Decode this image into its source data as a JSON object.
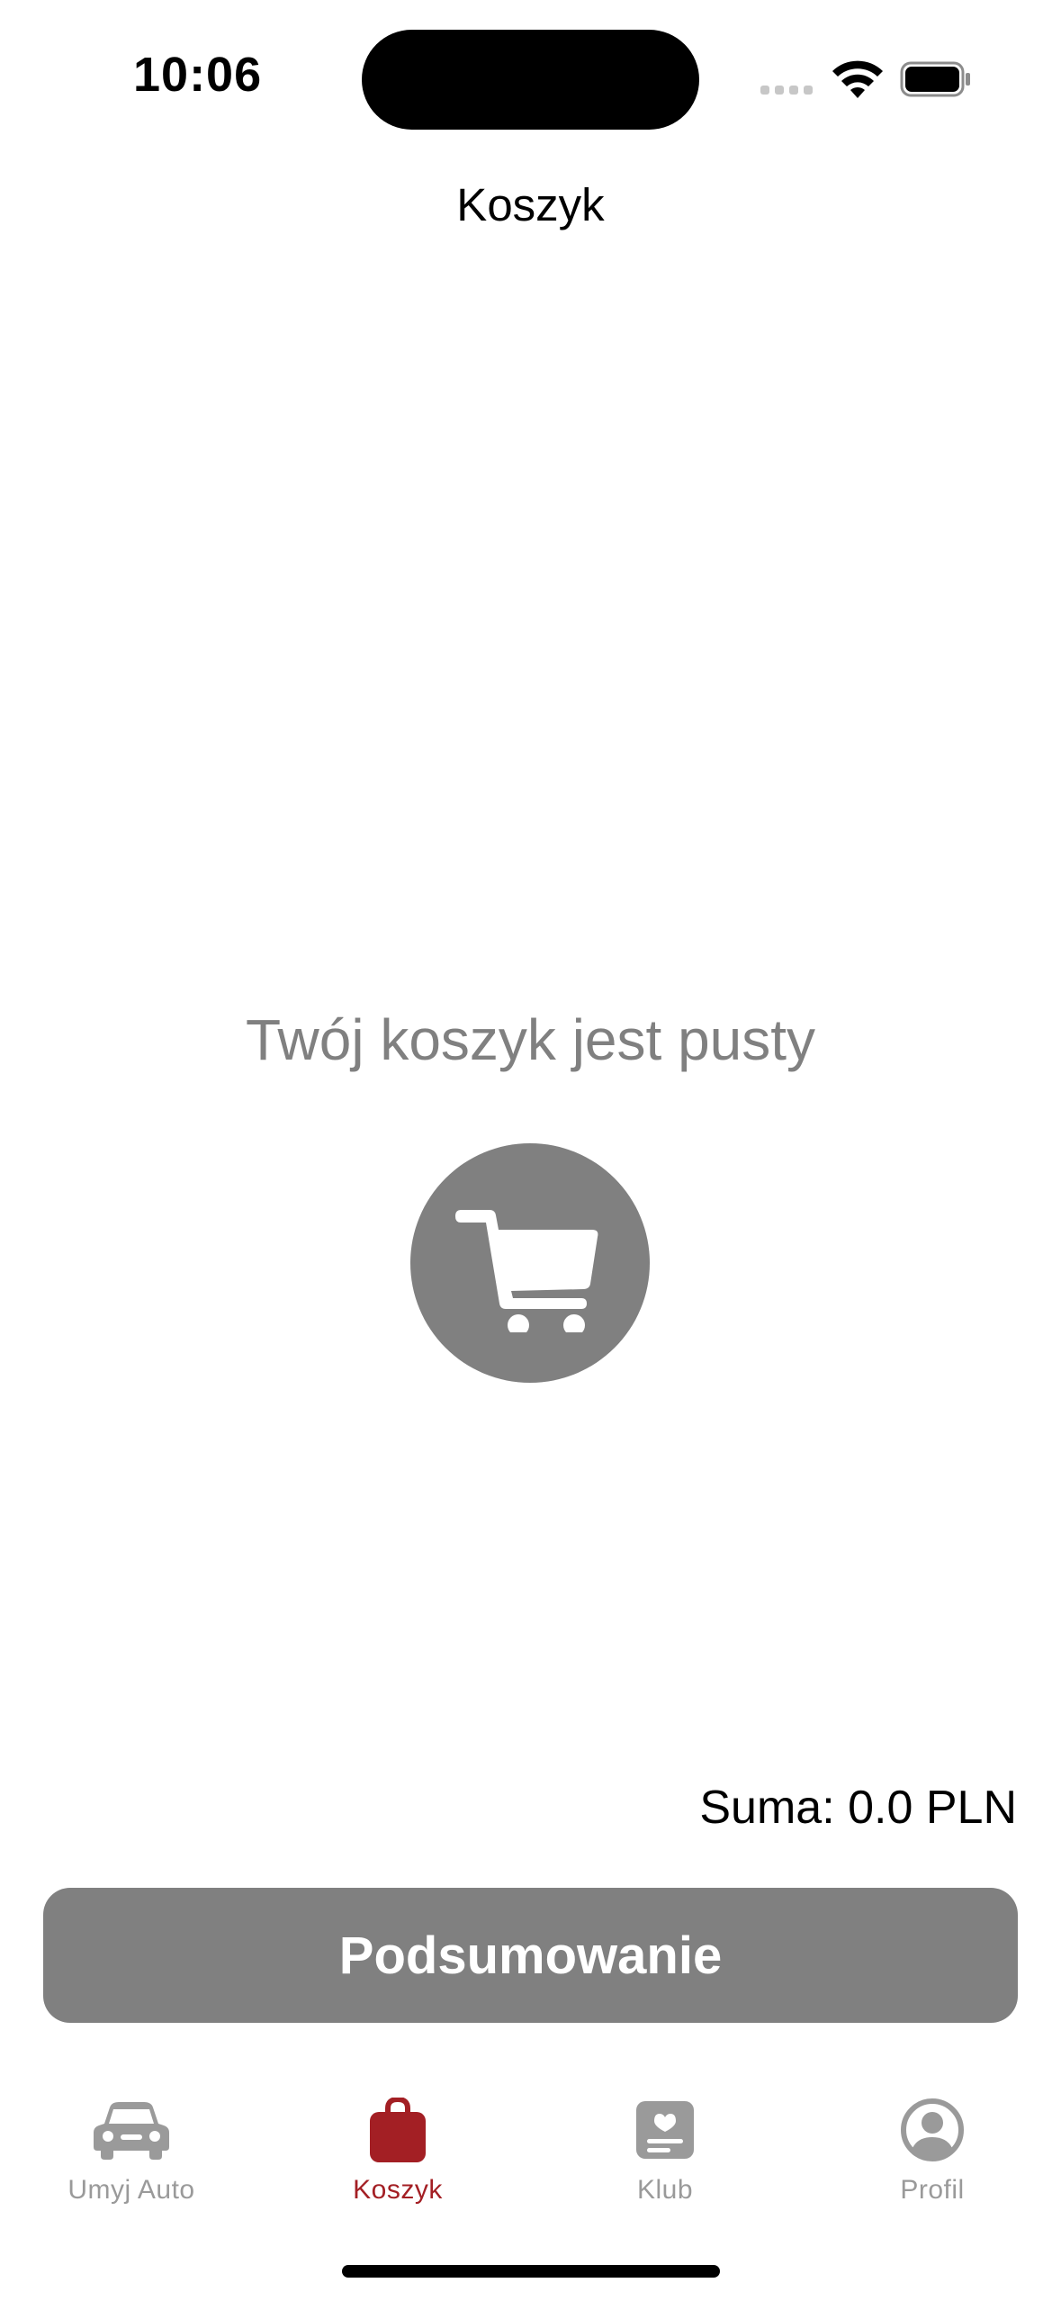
{
  "status_bar": {
    "time": "10:06"
  },
  "nav": {
    "title": "Koszyk"
  },
  "empty_state": {
    "message": "Twój koszyk jest pusty",
    "icon": "cart-icon"
  },
  "summary": {
    "total_text": "Suma: 0.0 PLN",
    "button_label": "Podsumowanie"
  },
  "tabbar": {
    "tabs": [
      {
        "label": "Umyj Auto",
        "icon": "car-icon"
      },
      {
        "label": "Koszyk",
        "icon": "bag-icon",
        "active": true
      },
      {
        "label": "Klub",
        "icon": "club-card-icon"
      },
      {
        "label": "Profil",
        "icon": "person-circle-icon"
      }
    ]
  },
  "colors": {
    "accent": "#a31f24",
    "inactive": "#9a9a9a",
    "button_bg": "#808080",
    "empty_text": "#808080"
  }
}
